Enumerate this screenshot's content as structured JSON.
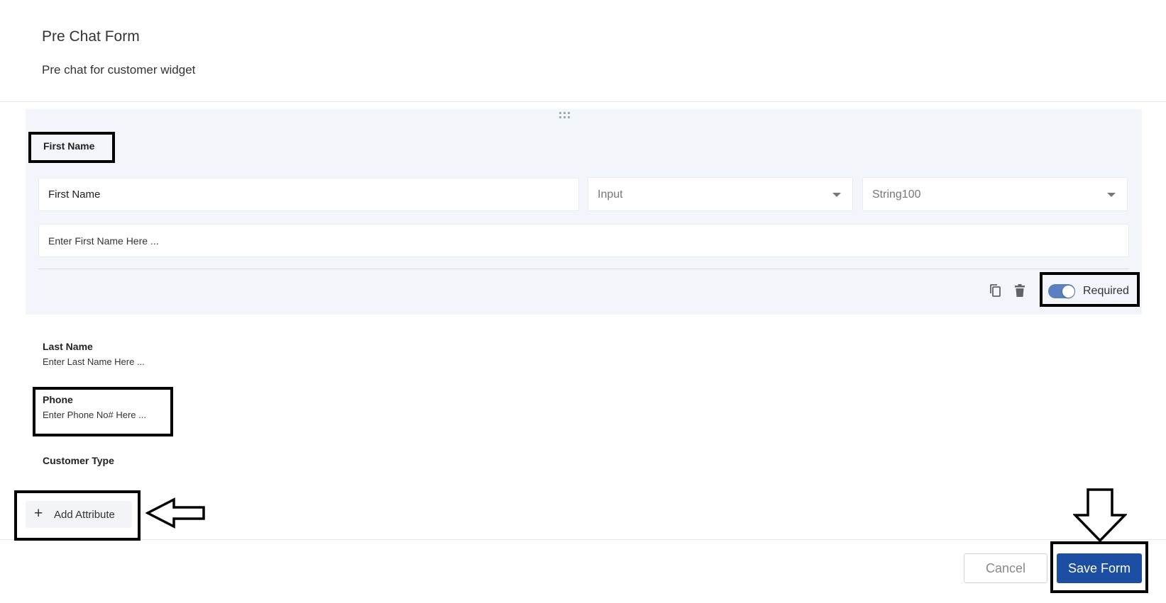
{
  "header": {
    "title": "Pre Chat Form",
    "subtitle": "Pre chat for customer widget"
  },
  "active_field": {
    "label": "First Name",
    "name_value": "First Name",
    "type_value": "Input",
    "format_value": "String100",
    "placeholder_value": "Enter First Name Here ...",
    "required_label": "Required",
    "required_on": true,
    "icons": [
      "copy-icon",
      "delete-icon",
      "drag-handle-icon"
    ]
  },
  "fields": [
    {
      "label": "Last Name",
      "placeholder": "Enter Last Name Here ..."
    },
    {
      "label": "Phone",
      "placeholder": "Enter Phone No# Here ..."
    },
    {
      "label": "Customer Type",
      "placeholder": ""
    }
  ],
  "add_attribute": {
    "label": "Add Attribute",
    "icon": "plus-icon"
  },
  "footer": {
    "cancel_label": "Cancel",
    "save_label": "Save Form"
  },
  "colors": {
    "primary": "#1c4fa3",
    "toggle": "#5b7fc0",
    "card_bg": "#f2f5fa",
    "annotation": "#000000"
  }
}
